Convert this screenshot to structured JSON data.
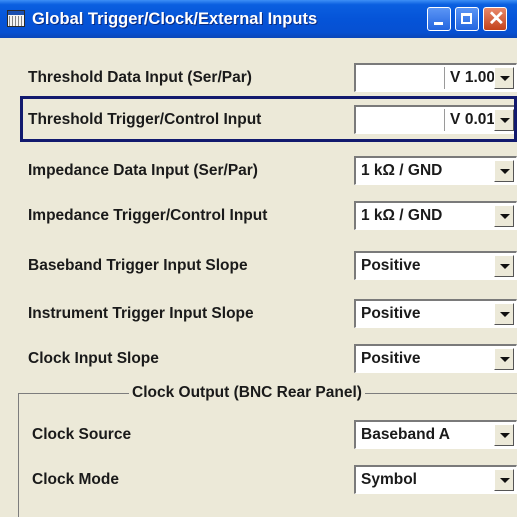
{
  "window": {
    "title": "Global Trigger/Clock/External Inputs",
    "icon": "table-window-icon"
  },
  "rows": [
    {
      "label": "Threshold Data Input (Ser/Par)",
      "value": "1.00",
      "unit": "V"
    },
    {
      "label": "Threshold Trigger/Control Input",
      "value": "0.01",
      "unit": "V"
    },
    {
      "label": "Impedance Data Input (Ser/Par)",
      "value": "1 kΩ / GND"
    },
    {
      "label": "Impedance Trigger/Control Input",
      "value": "1 kΩ / GND"
    },
    {
      "label": "Baseband Trigger Input Slope",
      "value": "Positive"
    },
    {
      "label": "Instrument Trigger Input Slope",
      "value": "Positive"
    },
    {
      "label": "Clock Input Slope",
      "value": "Positive"
    }
  ],
  "clock_output": {
    "legend": "Clock Output (BNC Rear Panel)",
    "rows": [
      {
        "label": "Clock Source",
        "value": "Baseband A"
      },
      {
        "label": "Clock Mode",
        "value": "Symbol"
      }
    ]
  }
}
